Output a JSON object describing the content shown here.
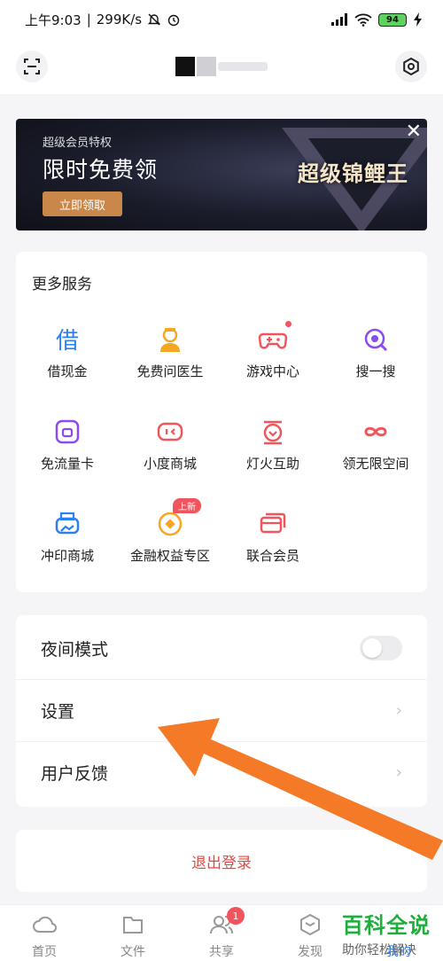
{
  "status": {
    "time": "上午9:03",
    "speed": "299K/s",
    "battery": "94"
  },
  "banner": {
    "subtitle": "超级会员特权",
    "headline": "限时免费领",
    "cta": "立即领取",
    "promo": "超级锦鲤王"
  },
  "services": {
    "title": "更多服务",
    "items": [
      {
        "label": "借现金",
        "icon": "borrow-cash-icon"
      },
      {
        "label": "免费问医生",
        "icon": "doctor-icon"
      },
      {
        "label": "游戏中心",
        "icon": "gamepad-icon"
      },
      {
        "label": "搜一搜",
        "icon": "search-icon"
      },
      {
        "label": "免流量卡",
        "icon": "sim-card-icon"
      },
      {
        "label": "小度商城",
        "icon": "xiaodu-icon"
      },
      {
        "label": "灯火互助",
        "icon": "mutual-aid-icon"
      },
      {
        "label": "领无限空间",
        "icon": "infinity-icon"
      },
      {
        "label": "冲印商城",
        "icon": "printer-icon"
      },
      {
        "label": "金融权益专区",
        "icon": "coin-icon"
      },
      {
        "label": "联合会员",
        "icon": "cards-icon"
      }
    ],
    "new_badge": "上新"
  },
  "settings": {
    "night_mode": "夜间模式",
    "settings": "设置",
    "feedback": "用户反馈"
  },
  "logout": "退出登录",
  "tabs": [
    {
      "label": "首页"
    },
    {
      "label": "文件"
    },
    {
      "label": "共享",
      "badge": "1"
    },
    {
      "label": "发现"
    },
    {
      "label": "我的"
    }
  ],
  "watermark": {
    "title": "百科全说",
    "subtitle": "助你轻松解决"
  },
  "colors": {
    "accent_red": "#f0555d",
    "logout_red": "#e04a45",
    "cta_gold": "#c9874a",
    "arrow_orange": "#f57a28"
  }
}
